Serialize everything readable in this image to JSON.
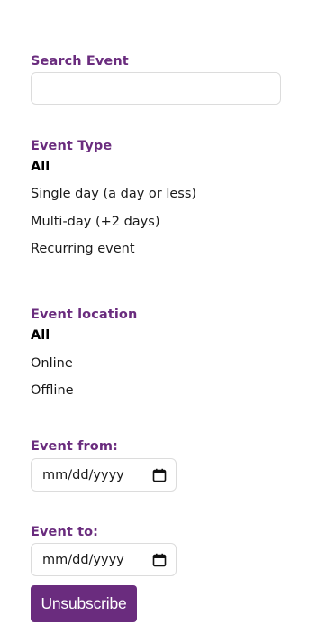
{
  "search": {
    "label": "Search Event",
    "value": "",
    "placeholder": ""
  },
  "event_type": {
    "label": "Event Type",
    "options": [
      "All",
      "Single day (a day or less)",
      "Multi-day (+2 days)",
      "Recurring event"
    ],
    "selected": "All"
  },
  "event_location": {
    "label": "Event location",
    "options": [
      "All",
      "Online",
      "Offline"
    ],
    "selected": "All"
  },
  "event_from": {
    "label": "Event from:",
    "placeholder": "mm/dd/yyyy"
  },
  "event_to": {
    "label": "Event to:",
    "placeholder": "mm/dd/yyyy"
  },
  "unsubscribe_button": {
    "label": "Unsubscribe"
  },
  "colors": {
    "accent": "#6a2c7e",
    "text": "#1a1a1a",
    "border": "#dcdcdc"
  },
  "icons": {
    "date_picker": "calendar-icon"
  }
}
